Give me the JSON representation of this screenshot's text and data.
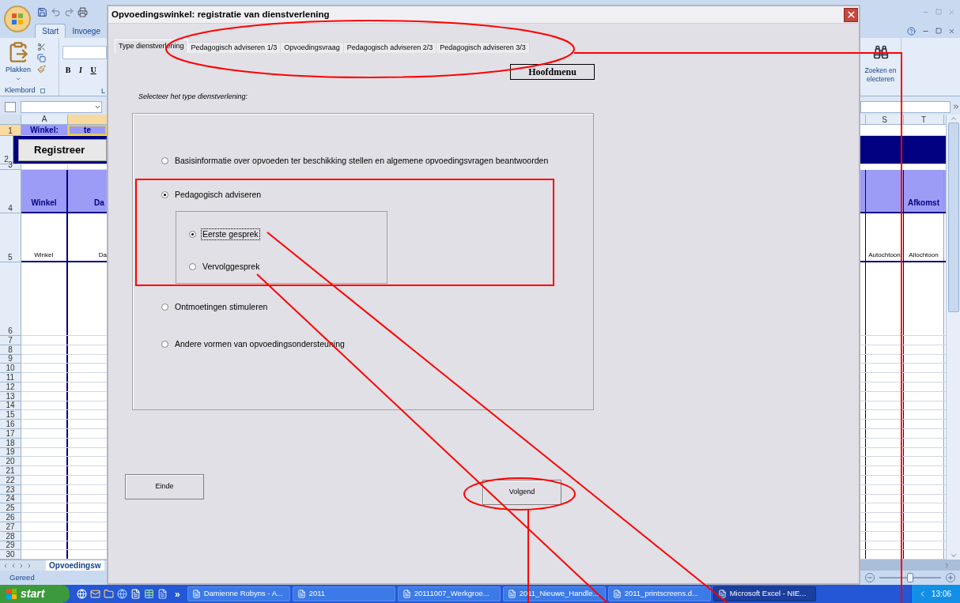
{
  "excel": {
    "ribbon_tabs": [
      {
        "label": "Start",
        "selected": true
      },
      {
        "label": "Invoege",
        "selected": false
      }
    ],
    "paste_label": "Plakken",
    "format_buttons": [
      "B",
      "I",
      "U"
    ],
    "group_labels": [
      "Klembord",
      "L"
    ],
    "find_labels": [
      "Zoeken en",
      "electeren"
    ],
    "columns_left": [
      "A"
    ],
    "columns_right": [
      "S",
      "T"
    ],
    "rows": [
      {
        "number": "1",
        "kind": "title",
        "selected": true,
        "left": [
          "Winkel:",
          "te"
        ]
      },
      {
        "number": "2",
        "kind": "button",
        "selected": false,
        "left": [
          "Registreer"
        ]
      },
      {
        "number": "3",
        "kind": "spacer",
        "selected": false
      },
      {
        "number": "4",
        "kind": "header",
        "selected": false,
        "left": [
          "Winkel",
          "Da"
        ],
        "right": {
          "t": "Afkomst"
        }
      },
      {
        "number": "5",
        "kind": "values",
        "selected": false,
        "left": [
          "Winkel",
          "Da"
        ],
        "right": {
          "s": "Autochtoon",
          "t": "Allochtoon"
        }
      },
      {
        "number": "6",
        "kind": "tall",
        "selected": false
      },
      {
        "number": "7",
        "kind": "blank",
        "selected": false
      },
      {
        "number": "8",
        "kind": "blank",
        "selected": false
      },
      {
        "number": "9",
        "kind": "blank",
        "selected": false
      },
      {
        "number": "10",
        "kind": "blank",
        "selected": false
      },
      {
        "number": "11",
        "kind": "blank",
        "selected": false
      },
      {
        "number": "12",
        "kind": "blank",
        "selected": false
      },
      {
        "number": "13",
        "kind": "blank",
        "selected": false
      },
      {
        "number": "14",
        "kind": "blank",
        "selected": false
      },
      {
        "number": "15",
        "kind": "blank",
        "selected": false
      },
      {
        "number": "16",
        "kind": "blank",
        "selected": false
      },
      {
        "number": "17",
        "kind": "blank",
        "selected": false
      },
      {
        "number": "18",
        "kind": "blank",
        "selected": false
      },
      {
        "number": "19",
        "kind": "blank",
        "selected": false
      },
      {
        "number": "20",
        "kind": "blank",
        "selected": false
      },
      {
        "number": "21",
        "kind": "blank",
        "selected": false
      },
      {
        "number": "22",
        "kind": "blank",
        "selected": false
      },
      {
        "number": "23",
        "kind": "blank",
        "selected": false
      },
      {
        "number": "24",
        "kind": "blank",
        "selected": false
      },
      {
        "number": "25",
        "kind": "blank",
        "selected": false
      },
      {
        "number": "26",
        "kind": "blank",
        "selected": false
      },
      {
        "number": "27",
        "kind": "blank",
        "selected": false
      },
      {
        "number": "28",
        "kind": "blank",
        "selected": false
      },
      {
        "number": "29",
        "kind": "blank",
        "selected": false
      },
      {
        "number": "30",
        "kind": "blank",
        "selected": false
      }
    ],
    "zoom": {
      "level": 0.5
    },
    "sheet_tab": "Opvoedingsw",
    "status": "Gereed"
  },
  "dialog": {
    "title": "Opvoedingswinkel: registratie van dienstverlening",
    "tabs": [
      {
        "label": "Type dienstverlening",
        "selected": true
      },
      {
        "label": "Pedagogisch adviseren 1/3",
        "selected": false
      },
      {
        "label": "Opvoedingsvraag",
        "selected": false
      },
      {
        "label": "Pedagogisch adviseren 2/3",
        "selected": false
      },
      {
        "label": "Pedagogisch adviseren 3/3",
        "selected": false
      }
    ],
    "menu_button": "Hoofdmenu",
    "prompt": "Selecteer het type dienstverlening:",
    "options": [
      {
        "label": "Basisinformatie over opvoeden ter beschikking stellen en algemene opvoedingsvragen beantwoorden",
        "selected": false
      },
      {
        "label": "Pedagogisch adviseren",
        "selected": true,
        "children": [
          {
            "label": "Eerste gesprek",
            "selected": true,
            "focused": true
          },
          {
            "label": "Vervolggesprek",
            "selected": false,
            "focused": false
          }
        ]
      },
      {
        "label": "Ontmoetingen stimuleren",
        "selected": false
      },
      {
        "label": "Andere vormen van opvoedingsondersteuning",
        "selected": false
      }
    ],
    "buttons": [
      "Einde",
      "Volgend"
    ]
  },
  "taskbar": {
    "start": "start",
    "more": "»",
    "tasks": [
      {
        "label": "Damienne Robyns - A...",
        "selected": false
      },
      {
        "label": "2011",
        "selected": false
      },
      {
        "label": "20111007_Werkgroe...",
        "selected": false
      },
      {
        "label": "2011_Nieuwe_Handle...",
        "selected": false
      },
      {
        "label": "2011_printscreens.d...",
        "selected": false
      },
      {
        "label": "Microsoft Excel - NIE...",
        "selected": true
      }
    ],
    "clock": "13:06"
  }
}
